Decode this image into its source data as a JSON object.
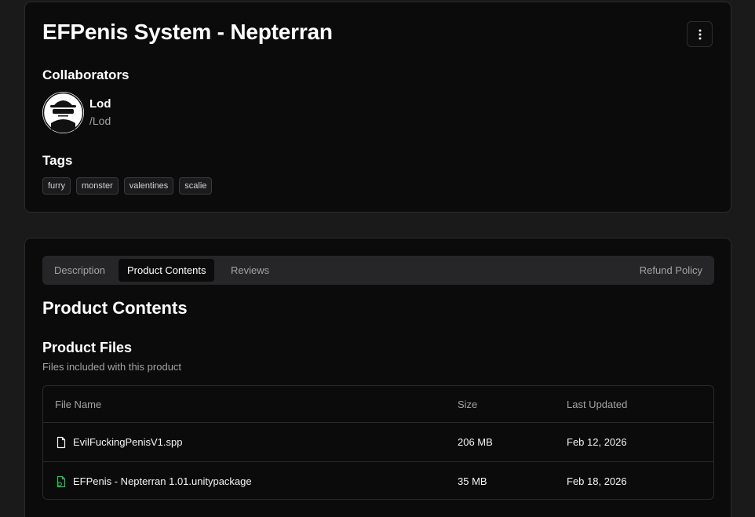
{
  "product": {
    "title": "EFPenis System - Nepterran"
  },
  "collaborators": {
    "heading": "Collaborators",
    "items": [
      {
        "name": "Lod",
        "handle": "/Lod"
      }
    ]
  },
  "tags": {
    "heading": "Tags",
    "items": [
      "furry",
      "monster",
      "valentines",
      "scalie"
    ]
  },
  "tabs": {
    "items": [
      "Description",
      "Product Contents",
      "Reviews"
    ],
    "active": "Product Contents",
    "right": "Refund Policy"
  },
  "contents": {
    "heading": "Product Contents",
    "files_heading": "Product Files",
    "files_subtitle": "Files included with this product",
    "columns": [
      "File Name",
      "Size",
      "Last Updated"
    ],
    "rows": [
      {
        "icon": "file-icon",
        "name": "EvilFuckingPenisV1.spp",
        "size": "206 MB",
        "updated": "Feb 12, 2026"
      },
      {
        "icon": "unity-package-icon",
        "name": "EFPenis - Nepterran 1.01.unitypackage",
        "size": "35 MB",
        "updated": "Feb 18, 2026"
      }
    ]
  },
  "colors": {
    "accent_green": "#22c55e",
    "background": "#1a1a1b",
    "card": "#0b0b0b"
  }
}
